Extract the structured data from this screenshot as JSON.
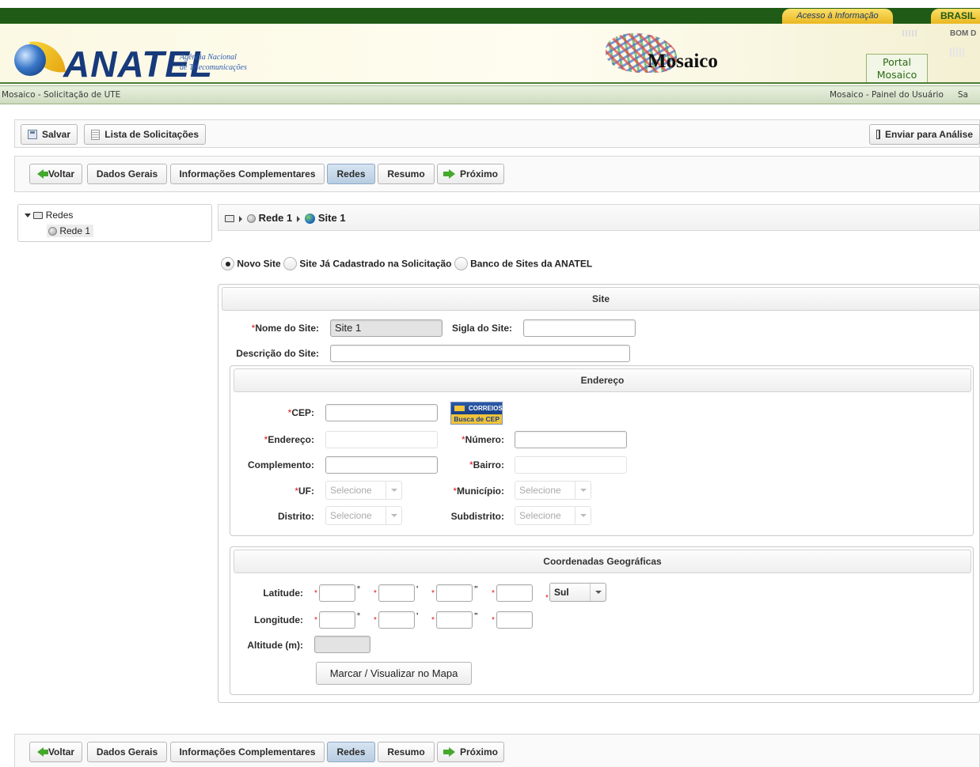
{
  "header": {
    "acesso": "Acesso à Informação",
    "brasil": "BRASIL",
    "bom": "BOM D",
    "logo": "ANATEL",
    "logo_sub_line1": "Agência Nacional",
    "logo_sub_line2": "de Telecomunicações",
    "app_title": "Mosaico",
    "portal_tab_line1": "Portal",
    "portal_tab_line2": "Mosaico"
  },
  "subbar": {
    "left": "Mosaico - Solicitação de UTE",
    "right_link": "Mosaico - Painel do Usuário",
    "right_cut": "Sa"
  },
  "toolbar": {
    "save": "Salvar",
    "list": "Lista de Solicitações",
    "send": "Enviar para Análise"
  },
  "wizard": {
    "back": "Voltar",
    "general": "Dados Gerais",
    "complementary": "Informações Complementares",
    "networks": "Redes",
    "summary": "Resumo",
    "next": "Próximo",
    "active": "Redes"
  },
  "tree": {
    "root": "Redes",
    "child": "Rede 1"
  },
  "breadcrumb": {
    "network": "Rede 1",
    "site": "Site 1"
  },
  "site_mode": {
    "options": [
      "Novo Site",
      "Site Já Cadastrado na Solicitação",
      "Banco de Sites da ANATEL"
    ],
    "selected": "Novo Site"
  },
  "site_form": {
    "legend": "Site",
    "name_label": "Nome do Site:",
    "name_value": "Site 1",
    "code_label": "Sigla do Site:",
    "code_value": "",
    "desc_label": "Descrição do Site:",
    "desc_value": ""
  },
  "address": {
    "legend": "Endereço",
    "cep_label": "CEP:",
    "correios_line1": "CORREIOS",
    "correios_line2": "Busca de CEP",
    "street_label": "Endereço:",
    "number_label": "Número:",
    "complement_label": "Complemento:",
    "district_label": "Bairro:",
    "uf_label": "UF:",
    "uf_value": "Selecione",
    "city_label": "Município:",
    "city_value": "Selecione",
    "distrito_label": "Distrito:",
    "distrito_value": "Selecione",
    "subdistrito_label": "Subdistrito:",
    "subdistrito_value": "Selecione"
  },
  "coords": {
    "legend": "Coordenadas Geográficas",
    "lat_label": "Latitude:",
    "lon_label": "Longitude:",
    "alt_label": "Altitude (m):",
    "hemisphere": "Sul",
    "map_button": "Marcar / Visualizar no Mapa"
  },
  "colors": {
    "top_bar": "#1f5b16",
    "accent_yellow": "#eab720",
    "active_tab": "#c5d7ea",
    "required_star": "#dd1111"
  }
}
